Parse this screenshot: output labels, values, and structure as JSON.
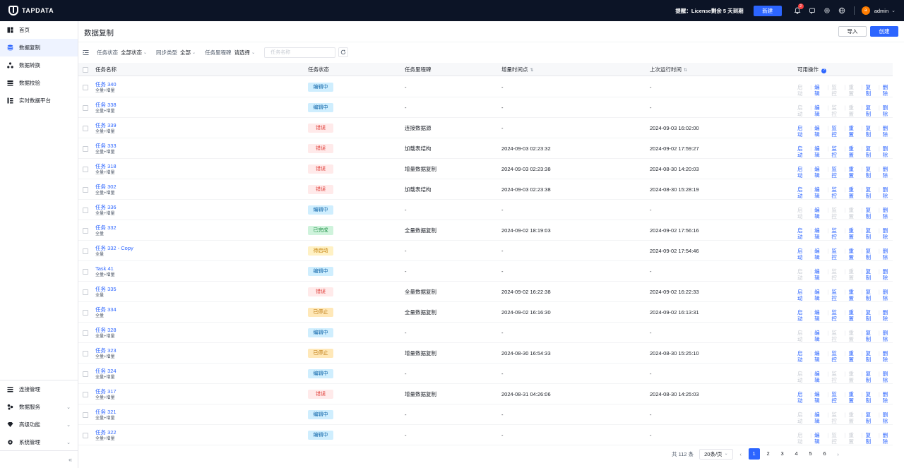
{
  "topbar": {
    "logo_text": "TAPDATA",
    "license_notice": "提醒：License剩余 5 天到期",
    "new_button": "新建",
    "notification_count": "2",
    "user_initial": "a",
    "user_name": "admin"
  },
  "sidebar": {
    "items": [
      {
        "label": "首页",
        "icon": "dashboard-icon"
      },
      {
        "label": "数据复制",
        "icon": "data-replication-icon"
      },
      {
        "label": "数据转换",
        "icon": "data-transform-icon"
      },
      {
        "label": "数据校验",
        "icon": "data-verify-icon"
      },
      {
        "label": "实时数据平台",
        "icon": "realtime-platform-icon"
      }
    ],
    "bottom_items": [
      {
        "label": "连接管理",
        "icon": "connection-icon"
      },
      {
        "label": "数据服务",
        "icon": "data-service-icon"
      },
      {
        "label": "高级功能",
        "icon": "advanced-icon"
      },
      {
        "label": "系统管理",
        "icon": "system-icon"
      }
    ]
  },
  "main": {
    "title": "数据复制",
    "import_button": "导入",
    "create_button": "创建",
    "filters": {
      "status_label": "任务状态",
      "status_value": "全部状态",
      "sync_label": "同步类型",
      "sync_value": "全部",
      "milestone_label": "任务里程碑",
      "milestone_value": "请选择",
      "search_placeholder": "任务名称"
    },
    "columns": {
      "name": "任务名称",
      "status": "任务状态",
      "milestone": "任务里程碑",
      "incremental_time": "增量时间点",
      "last_run": "上次运行时间",
      "actions": "可用操作"
    },
    "op_labels": [
      "启动",
      "编辑",
      "监控",
      "重置",
      "复制",
      "删除"
    ],
    "rows": [
      {
        "name": "任务 340",
        "type": "全量+增量",
        "status": "编辑中",
        "status_kind": "edit",
        "milestone": "-",
        "incremental": "-",
        "last_run": "-",
        "ops_enabled": [
          false,
          true,
          false,
          false,
          true,
          true
        ]
      },
      {
        "name": "任务 338",
        "type": "全量+增量",
        "status": "编辑中",
        "status_kind": "edit",
        "milestone": "-",
        "incremental": "-",
        "last_run": "-",
        "ops_enabled": [
          false,
          true,
          false,
          false,
          true,
          true
        ]
      },
      {
        "name": "任务 339",
        "type": "全量+增量",
        "status": "错误",
        "status_kind": "err",
        "milestone": "连接数据源",
        "incremental": "-",
        "last_run": "2024-09-03 16:02:00",
        "ops_enabled": [
          true,
          true,
          true,
          true,
          true,
          true
        ]
      },
      {
        "name": "任务 333",
        "type": "全量+增量",
        "status": "错误",
        "status_kind": "err",
        "milestone": "加载表结构",
        "incremental": "2024-09-03 02:23:32",
        "last_run": "2024-09-02 17:59:27",
        "ops_enabled": [
          true,
          true,
          true,
          true,
          true,
          true
        ]
      },
      {
        "name": "任务 318",
        "type": "全量+增量",
        "status": "错误",
        "status_kind": "err",
        "milestone": "增量数据复制",
        "incremental": "2024-09-03 02:23:38",
        "last_run": "2024-08-30 14:20:03",
        "ops_enabled": [
          true,
          true,
          true,
          true,
          true,
          true
        ]
      },
      {
        "name": "任务 302",
        "type": "全量+增量",
        "status": "错误",
        "status_kind": "err",
        "milestone": "加载表结构",
        "incremental": "2024-09-03 02:23:38",
        "last_run": "2024-08-30 15:28:19",
        "ops_enabled": [
          true,
          true,
          true,
          true,
          true,
          true
        ]
      },
      {
        "name": "任务 336",
        "type": "全量+增量",
        "status": "编辑中",
        "status_kind": "edit",
        "milestone": "-",
        "incremental": "-",
        "last_run": "-",
        "ops_enabled": [
          false,
          true,
          false,
          false,
          true,
          true
        ]
      },
      {
        "name": "任务 332",
        "type": "全量",
        "status": "已完成",
        "status_kind": "done",
        "milestone": "全量数据复制",
        "incremental": "2024-09-02 18:19:03",
        "last_run": "2024-09-02 17:56:16",
        "ops_enabled": [
          true,
          true,
          true,
          true,
          true,
          true
        ]
      },
      {
        "name": "任务 332 - Copy",
        "type": "全量",
        "status": "待启动",
        "status_kind": "wait",
        "milestone": "-",
        "incremental": "-",
        "last_run": "2024-09-02 17:54:46",
        "ops_enabled": [
          true,
          true,
          true,
          true,
          true,
          true
        ]
      },
      {
        "name": "Task 41",
        "type": "全量+增量",
        "status": "编辑中",
        "status_kind": "edit",
        "milestone": "-",
        "incremental": "-",
        "last_run": "-",
        "ops_enabled": [
          false,
          true,
          false,
          false,
          true,
          true
        ]
      },
      {
        "name": "任务 335",
        "type": "全量",
        "status": "错误",
        "status_kind": "err",
        "milestone": "全量数据复制",
        "incremental": "2024-09-02 16:22:38",
        "last_run": "2024-09-02 16:22:33",
        "ops_enabled": [
          true,
          true,
          true,
          true,
          true,
          true
        ]
      },
      {
        "name": "任务 334",
        "type": "全量",
        "status": "已停止",
        "status_kind": "stop",
        "milestone": "全量数据复制",
        "incremental": "2024-09-02 16:16:30",
        "last_run": "2024-09-02 16:13:31",
        "ops_enabled": [
          true,
          true,
          true,
          true,
          true,
          true
        ]
      },
      {
        "name": "任务 328",
        "type": "全量+增量",
        "status": "编辑中",
        "status_kind": "edit",
        "milestone": "-",
        "incremental": "-",
        "last_run": "-",
        "ops_enabled": [
          false,
          true,
          false,
          false,
          true,
          true
        ]
      },
      {
        "name": "任务 323",
        "type": "全量+增量",
        "status": "已停止",
        "status_kind": "stop",
        "milestone": "增量数据复制",
        "incremental": "2024-08-30 16:54:33",
        "last_run": "2024-08-30 15:25:10",
        "ops_enabled": [
          true,
          true,
          true,
          true,
          true,
          true
        ]
      },
      {
        "name": "任务 324",
        "type": "全量+增量",
        "status": "编辑中",
        "status_kind": "edit",
        "milestone": "-",
        "incremental": "-",
        "last_run": "-",
        "ops_enabled": [
          false,
          true,
          false,
          false,
          true,
          true
        ]
      },
      {
        "name": "任务 317",
        "type": "全量+增量",
        "status": "错误",
        "status_kind": "err",
        "milestone": "增量数据复制",
        "incremental": "2024-08-31 04:26:06",
        "last_run": "2024-08-30 14:25:03",
        "ops_enabled": [
          true,
          true,
          true,
          true,
          true,
          true
        ]
      },
      {
        "name": "任务 321",
        "type": "全量+增量",
        "status": "编辑中",
        "status_kind": "edit",
        "milestone": "-",
        "incremental": "-",
        "last_run": "-",
        "ops_enabled": [
          false,
          true,
          false,
          false,
          true,
          true
        ]
      },
      {
        "name": "任务 322",
        "type": "全量+增量",
        "status": "编辑中",
        "status_kind": "edit",
        "milestone": "-",
        "incremental": "-",
        "last_run": "-",
        "ops_enabled": [
          false,
          true,
          false,
          false,
          true,
          true
        ]
      }
    ],
    "pagination": {
      "total": "共 112 条",
      "page_size": "20条/页",
      "pages": [
        "1",
        "2",
        "3",
        "4",
        "5",
        "6"
      ],
      "current": "1"
    }
  }
}
